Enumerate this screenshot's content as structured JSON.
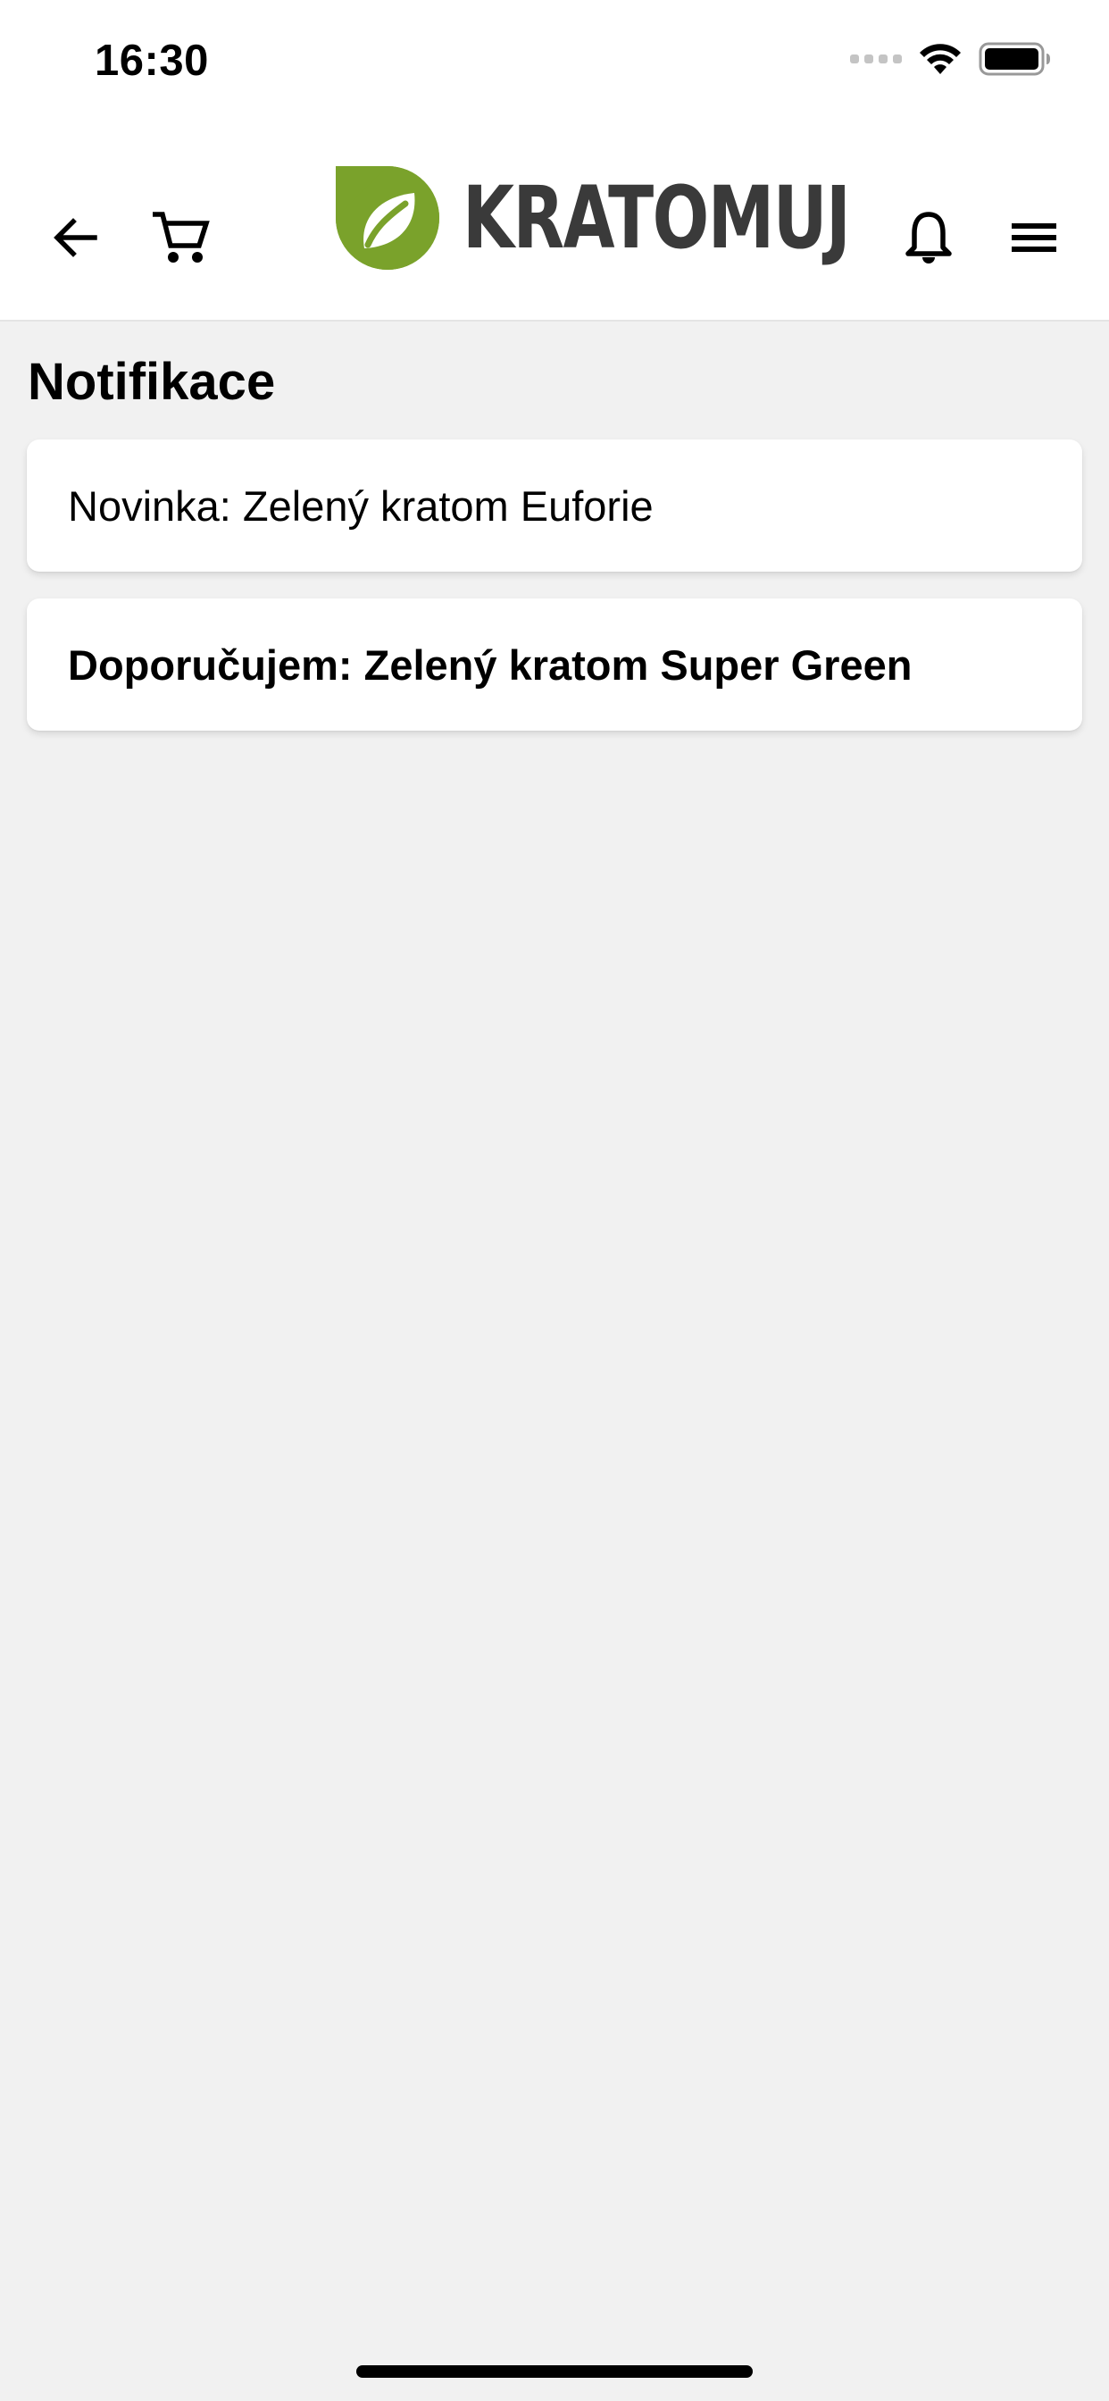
{
  "status_bar": {
    "time": "16:30"
  },
  "header": {
    "logo_text": "KRATOMUJ",
    "brand_color": "#7aa22b",
    "icons": [
      "back-arrow-icon",
      "cart-icon",
      "bell-icon",
      "menu-icon"
    ]
  },
  "page": {
    "title": "Notifikace"
  },
  "notifications": [
    {
      "text": "Novinka: Zelený kratom Euforie",
      "read": true
    },
    {
      "text": "Doporučujem: Zelený kratom Super Green",
      "read": false
    }
  ]
}
